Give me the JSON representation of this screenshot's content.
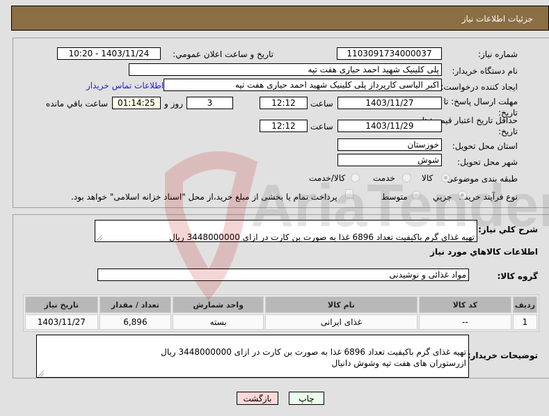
{
  "header": {
    "title": "جزئیات اطلاعات نیاز"
  },
  "form": {
    "need_number": {
      "label": "شماره نیاز:",
      "value": "1103091734000037"
    },
    "announce_datetime": {
      "label": "تاریخ و ساعت اعلان عمومي:",
      "value": "1403/11/24 - 10:20"
    },
    "buyer_org": {
      "label": "نام دستگاه خریدار:",
      "value": "پلی کلینیک شهید احمد حیاری هفت تپه"
    },
    "requester": {
      "label": "ایجاد کننده درخواست:",
      "value": "اکبر الیاسی کارپرداز پلی کلینیک شهید احمد حیاری هفت تپه",
      "contact_link": "اطلاعات تماس خریدار"
    },
    "response_deadline": {
      "label": "مهلت ارسال پاسخ: تا تاریخ:",
      "date": "1403/11/27",
      "time_label": "ساعت",
      "time": "12:12",
      "days": "3",
      "days_label": "روز و",
      "remaining": "01:14:25",
      "remaining_label": "ساعت باقي مانده"
    },
    "price_validity": {
      "label": "حداقل تاریخ اعتبار قیمت: تا تاریخ:",
      "date": "1403/11/29",
      "time_label": "ساعت",
      "time": "12:12"
    },
    "delivery_province": {
      "label": "استان محل تحویل:",
      "value": "خوزستان"
    },
    "delivery_city": {
      "label": "شهر محل تحویل:",
      "value": "شوش"
    },
    "category": {
      "label": "طبقه بندی موضوعی:",
      "options": [
        "کالا",
        "خدمت",
        "کالا/خدمت"
      ],
      "selected": "کالا"
    },
    "purchase_type": {
      "label": "نوع فرآیند خرید :",
      "options": [
        "جزیي",
        "متوسط"
      ],
      "selected": "جزیي",
      "payment_checkbox_label": "پرداخت تمام یا بخشی از مبلغ خرید،از محل \"اسناد خزانه اسلامی\" خواهد بود."
    }
  },
  "details": {
    "summary_label": "شرح کلي نیاز:",
    "summary_text": "تهیه غذای گرم باکیفیت تعداد 6896 غذا به صورت بن کارت در ازای 3448000000 ریال\nازرستوران های هفت تپه وشوش دانیال",
    "goods_section_title": "اطلاعات کالاهاي مورد نیاز",
    "goods_group_label": "گروه کالا:",
    "goods_group_value": "مواد غذائی و نوشیدنی",
    "table": {
      "headers": [
        "ردیف",
        "کد کالا",
        "نام کالا",
        "واحد شمارش",
        "تعداد / مقدار",
        "تاریخ نیاز"
      ],
      "rows": [
        [
          "1",
          "--",
          "غذای ایرانی",
          "بسته",
          "6,896",
          "1403/11/27"
        ]
      ]
    },
    "buyer_notes_label": "توضیحات خریدار:",
    "buyer_notes_text": "تهیه غذای گرم باکیفیت تعداد 6896 غذا به صورت بن کارت در ازای 3448000000 ریال\nازرستوران های هفت تپه وشوش دانیال"
  },
  "buttons": {
    "print": "چاپ",
    "back": "بازگشت"
  },
  "watermark": {
    "text": "AriaTender.neT"
  },
  "colors": {
    "header_bg": "#8b6e43",
    "link": "#2222cc",
    "print_bg": "#eaffea",
    "back_bg": "#ffd8d8"
  }
}
